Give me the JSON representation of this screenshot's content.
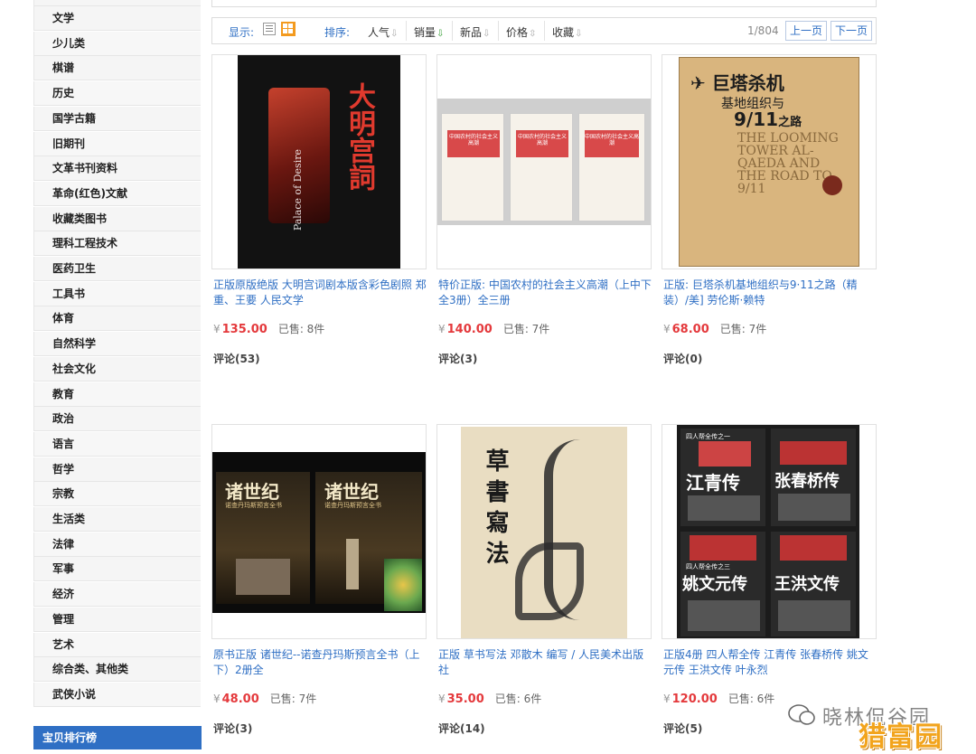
{
  "sidebar": {
    "categories": [
      "文学",
      "少儿类",
      "棋谱",
      "历史",
      "国学古籍",
      "旧期刊",
      "文革书刊资料",
      "革命(红色)文献",
      "收藏类图书",
      "理科工程技术",
      "医药卫生",
      "工具书",
      "体育",
      "自然科学",
      "社会文化",
      "教育",
      "政治",
      "语言",
      "哲学",
      "宗教",
      "生活类",
      "法律",
      "军事",
      "经济",
      "管理",
      "艺术",
      "综合类、其他类",
      "武侠小说"
    ],
    "rank_header": "宝贝排行榜"
  },
  "toolbar": {
    "display_label": "显示:",
    "sort_label": "排序:",
    "sorts": [
      "人气",
      "销量",
      "新品",
      "价格",
      "收藏"
    ],
    "page_info": "1/804",
    "prev_label": "上一页",
    "next_label": "下一页"
  },
  "products": [
    {
      "title": "正版原版绝版 大明宫词剧本版含彩色剧照 郑重、王要 人民文学",
      "currency": "¥",
      "price": "135.00",
      "sold": "已售: 8件",
      "reviews": "评论(53)"
    },
    {
      "title": "特价正版: 中国农村的社会主义高潮（上中下全3册）全三册",
      "currency": "¥",
      "price": "140.00",
      "sold": "已售: 7件",
      "reviews": "评论(3)"
    },
    {
      "title": "正版: 巨塔杀机基地组织与9·11之路（精装）/美] 劳伦斯·赖特",
      "currency": "¥",
      "price": "68.00",
      "sold": "已售: 7件",
      "reviews": "评论(0)"
    },
    {
      "title": "原书正版 诸世纪--诺查丹玛斯预言全书（上下）2册全",
      "currency": "¥",
      "price": "48.00",
      "sold": "已售: 7件",
      "reviews": "评论(3)"
    },
    {
      "title": "正版 草书写法 邓散木 编写 / 人民美术出版社",
      "currency": "¥",
      "price": "35.00",
      "sold": "已售: 6件",
      "reviews": "评论(14)"
    },
    {
      "title": "正版4册 四人帮全传 江青传 张春桥传 姚文元传 王洪文传 叶永烈",
      "currency": "¥",
      "price": "120.00",
      "sold": "已售: 6件",
      "reviews": "评论(5)"
    }
  ],
  "covers": {
    "p1_title": "大明宫詞",
    "p1_sub": "Palace of Desire",
    "p2_book": "中国农村的社会主义高潮",
    "p3_cn": "巨塔杀机",
    "p3_cn2": "基地组织与",
    "p3_num": "9/11",
    "p3_cn3": "之路",
    "p3_en": "THE LOOMING TOWER AL-QAEDA AND THE ROAD TO 9/11",
    "p4_title": "诸世纪",
    "p4_sub": "诺查丹玛斯预言全书",
    "p5_title": "草書寫法",
    "p6_t1": "江青传",
    "p6_t2": "张春桥传",
    "p6_t3": "姚文元传",
    "p6_t4": "王洪文传",
    "p6_series1": "四人帮全传之一",
    "p6_series3": "四人帮全传之三"
  },
  "watermark": {
    "text": "晓林侃谷园",
    "brand": "猎富园"
  },
  "colors": {
    "link": "#2f6fc4",
    "price": "#e4393c",
    "rank_header": "#2f6fc4",
    "grid_active": "#f39a1e"
  }
}
